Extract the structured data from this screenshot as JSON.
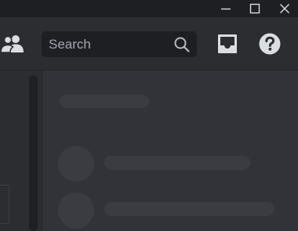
{
  "search": {
    "placeholder": "Search"
  },
  "icons": {
    "friends": "people-icon",
    "search": "search-icon",
    "inbox": "inbox-icon",
    "help": "help-icon",
    "window_min": "minimize-icon",
    "window_max": "maximize-icon",
    "window_close": "close-icon"
  },
  "colors": {
    "titlebar": "#1e1f22",
    "header": "#2b2d31",
    "main": "#313338",
    "search_bg": "#1e1f22",
    "icon": "#dbdee1",
    "skeleton": "#3a3c42"
  }
}
